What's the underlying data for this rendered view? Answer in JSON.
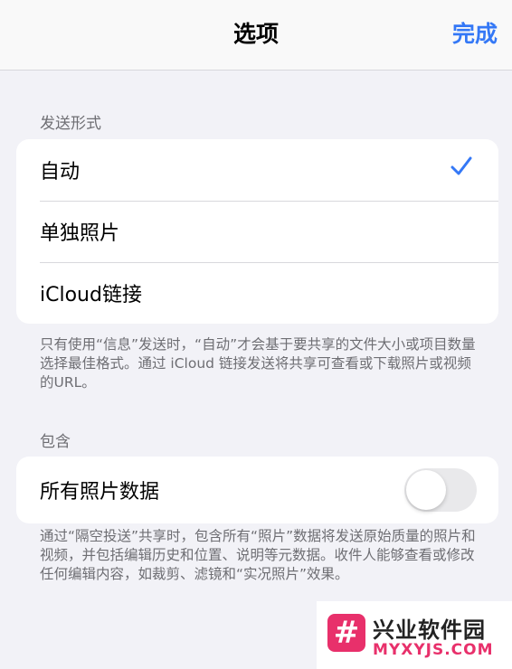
{
  "navbar": {
    "title": "选项",
    "done_label": "完成"
  },
  "send_format": {
    "header": "发送形式",
    "options": [
      {
        "label": "自动",
        "selected": true
      },
      {
        "label": "单独照片",
        "selected": false
      },
      {
        "label": "iCloud链接",
        "selected": false
      }
    ],
    "footer": "只有使用“信息”发送时，“自动”才会基于要共享的文件大小或项目数量选择最佳格式。通过 iCloud 链接发送将共享可查看或下载照片或视频的URL。"
  },
  "include": {
    "header": "包含",
    "all_photo_data": {
      "label": "所有照片数据",
      "enabled": false
    },
    "footer": "通过“隔空投送”共享时，包含所有“照片”数据将发送原始质量的照片和视频，并包括编辑历史和位置、说明等元数据。收件人能够查看或修改任何编辑内容，如裁剪、滤镜和“实况照片”效果。"
  },
  "watermark": {
    "logo_glyph": "#",
    "name": "兴业软件园",
    "site": "MYXYJS.COM"
  },
  "colors": {
    "accent": "#3478f6",
    "background": "#f2f2f7",
    "watermark": "#e8306b"
  },
  "icons": {
    "checkmark": "checkmark-icon"
  }
}
